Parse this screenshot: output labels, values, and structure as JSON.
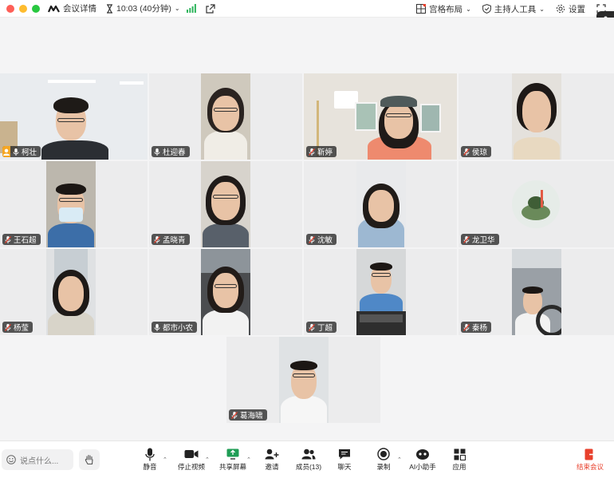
{
  "titlebar": {
    "meeting_info": "会议详情",
    "timer": "10:03 (40分钟)",
    "layout": "宫格布局",
    "host_tools": "主持人工具",
    "settings": "设置"
  },
  "participants": [
    {
      "name": "柯壮"
    },
    {
      "name": "杜迎春"
    },
    {
      "name": "靳婷"
    },
    {
      "name": "侯琼"
    },
    {
      "name": "王石超"
    },
    {
      "name": "孟晓青"
    },
    {
      "name": "沈敏"
    },
    {
      "name": "龙卫华"
    },
    {
      "name": "杨莹"
    },
    {
      "name": "都市小农"
    },
    {
      "name": "丁超"
    },
    {
      "name": "秦杨"
    },
    {
      "name": "葛海啸"
    }
  ],
  "toolbar": {
    "chat_placeholder": "说点什么...",
    "mute": "静音",
    "stop_video": "停止视频",
    "share_screen": "共享屏幕",
    "invite": "邀请",
    "members": "成员(13)",
    "chat": "聊天",
    "record": "录制",
    "ai_assistant": "AI小助手",
    "apps": "应用",
    "end_meeting": "结束会议"
  },
  "colors": {
    "active_speaker": "#35c28a",
    "end_meeting": "#e8402c",
    "host_badge": "#f5a623",
    "muted_mic": "#e8402c"
  }
}
